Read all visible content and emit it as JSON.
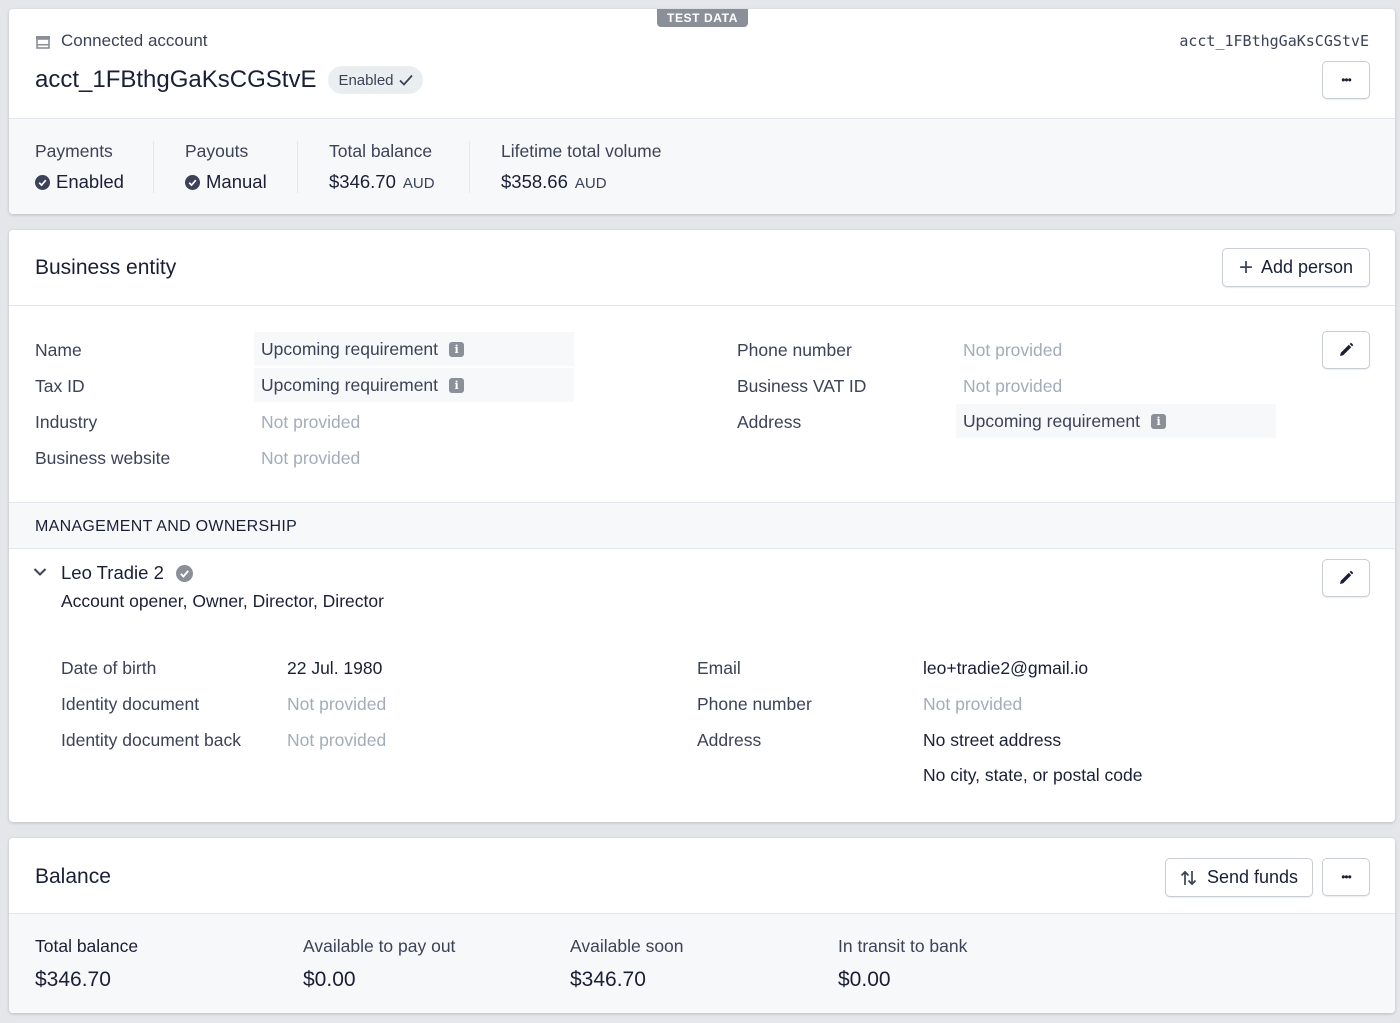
{
  "test_badge": "TEST DATA",
  "account": {
    "connected_label": "Connected account",
    "id_mono": "acct_1FBthgGaKsCGStvE",
    "title": "acct_1FBthgGaKsCGStvE",
    "status": "Enabled",
    "more_label": "•••"
  },
  "stats": {
    "payments": {
      "label": "Payments",
      "value": "Enabled"
    },
    "payouts": {
      "label": "Payouts",
      "value": "Manual"
    },
    "total_balance": {
      "label": "Total balance",
      "value": "$346.70",
      "currency": "AUD"
    },
    "lifetime_volume": {
      "label": "Lifetime total volume",
      "value": "$358.66",
      "currency": "AUD"
    }
  },
  "business": {
    "title": "Business entity",
    "add_person": "Add person",
    "fields_left": [
      {
        "label": "Name",
        "value": "Upcoming requirement"
      },
      {
        "label": "Tax ID",
        "value": "Upcoming requirement"
      },
      {
        "label": "Industry",
        "value": "Not provided"
      },
      {
        "label": "Business website",
        "value": "Not provided"
      }
    ],
    "fields_right": [
      {
        "label": "Phone number",
        "value": "Not provided"
      },
      {
        "label": "Business VAT ID",
        "value": "Not provided"
      },
      {
        "label": "Address",
        "value": "Upcoming requirement"
      }
    ],
    "management_title": "MANAGEMENT AND OWNERSHIP",
    "person": {
      "name": "Leo Tradie 2",
      "roles": "Account opener, Owner, Director, Director",
      "fields_left": [
        {
          "label": "Date of birth",
          "value": "22 Jul. 1980"
        },
        {
          "label": "Identity document",
          "value": "Not provided"
        },
        {
          "label": "Identity document back",
          "value": "Not provided"
        }
      ],
      "fields_right": [
        {
          "label": "Email",
          "value": "leo+tradie2@gmail.io"
        },
        {
          "label": "Phone number",
          "value": "Not provided"
        },
        {
          "label": "Address",
          "value": "No street address",
          "value2": "No city, state, or postal code"
        }
      ]
    }
  },
  "balance": {
    "title": "Balance",
    "send_funds": "Send funds",
    "more_label": "•••",
    "items": [
      {
        "label": "Total balance",
        "value": "$346.70"
      },
      {
        "label": "Available to pay out",
        "value": "$0.00"
      },
      {
        "label": "Available soon",
        "value": "$346.70"
      },
      {
        "label": "In transit to bank",
        "value": "$0.00"
      }
    ]
  },
  "colors": {
    "background": "#e4e6ea",
    "text": "#1a1f36",
    "secondary_text": "#3c4257",
    "muted_text": "#a3acb9",
    "badge": "#8a8f98",
    "subtle_bg": "#f7f8fa"
  }
}
